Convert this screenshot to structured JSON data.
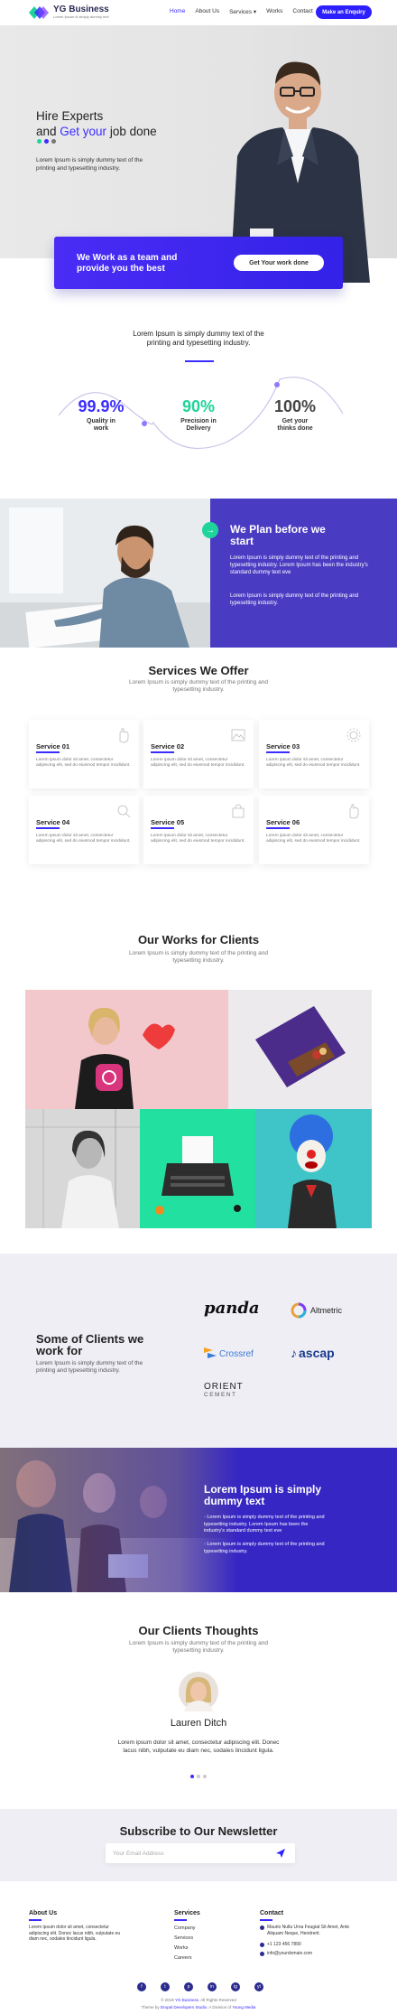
{
  "header": {
    "brand": "YG Business",
    "tagline": "Lorem Ipsum is simply dummy text",
    "nav": [
      "Home",
      "About Us",
      "Services",
      "Works",
      "Contact"
    ],
    "services_caret": "▾",
    "cta": "Make an Enquiry"
  },
  "hero": {
    "title_line1": "Hire Experts",
    "title_and": "and ",
    "title_accent": "Get your",
    "title_rest": " job done",
    "description": "Lorem Ipsum is simply dummy text of the printing and typesetting industry.",
    "dot_colors": [
      "#1ed49a",
      "#3a2cff",
      "#777777"
    ]
  },
  "cta_bar": {
    "text": "We Work as a team and provide you the best",
    "button": "Get Your work done"
  },
  "stats": {
    "heading": "Lorem Ipsum is simply dummy text of the printing and typesetting industry.",
    "items": [
      {
        "value": "99.9%",
        "label": "Quality in work",
        "color": "#3a2cff"
      },
      {
        "value": "90%",
        "label": "Precision in Delivery",
        "color": "#1ed49a"
      },
      {
        "value": "100%",
        "label": "Get your thinks done",
        "color": "#444444"
      }
    ]
  },
  "plan": {
    "arrow": "→",
    "title": "We Plan before we start",
    "p1": "Lorem Ipsum is simply dummy text of the printing and typesetting industry. Lorem Ipsum has been the industry's standard dummy text eve",
    "p2": "Lorem Ipsum is simply dummy text of the printing and typesetting industry."
  },
  "services": {
    "title": "Services We Offer",
    "subtitle": "Lorem Ipsum is simply dummy text of the printing and typesetting industry.",
    "items": [
      {
        "title": "Service 01",
        "desc": "Lorem ipsum dolor sit amet, consectetur adipiscing elit, sed do eiusmod tempor incididunt."
      },
      {
        "title": "Service 02",
        "desc": "Lorem ipsum dolor sit amet, consectetur adipiscing elit, sed do eiusmod tempor incididunt."
      },
      {
        "title": "Service 03",
        "desc": "Lorem ipsum dolor sit amet, consectetur adipiscing elit, sed do eiusmod tempor incididunt."
      },
      {
        "title": "Service 04",
        "desc": "Lorem ipsum dolor sit amet, consectetur adipiscing elit, sed do eiusmod tempor incididunt."
      },
      {
        "title": "Service 05",
        "desc": "Lorem ipsum dolor sit amet, consectetur adipiscing elit, sed do eiusmod tempor incididunt."
      },
      {
        "title": "Service 06",
        "desc": "Lorem ipsum dolor sit amet, consectetur adipiscing elit, sed do eiusmod tempor incididunt."
      }
    ]
  },
  "works": {
    "title": "Our Works for Clients",
    "subtitle": "Lorem Ipsum is simply dummy text of the printing and typesetting industry."
  },
  "clients": {
    "title": "Some of Clients we work for",
    "description": "Lorem Ipsum is simply dummy text of the printing and typesetting industry.",
    "logos": [
      "panda",
      "Altmetric",
      "Crossref",
      "ascap",
      "ORIENT",
      "CEMENT"
    ]
  },
  "band": {
    "title": "Lorem Ipsum is simply dummy text",
    "p1": "- Lorem Ipsum is simply dummy text of the printing and typesetting industry. Lorem Ipsum has been the industry's standard dummy text eve",
    "p2": "- Lorem Ipsum is simply dummy text of the printing and typesetting industry."
  },
  "testimonials": {
    "title": "Our Clients Thoughts",
    "subtitle": "Lorem Ipsum is simply dummy text of the printing and typesetting industry.",
    "name": "Lauren Ditch",
    "quote": "Lorem ipsum dolor sit amet, consectetur adipiscing elit. Donec lacus nibh, vulputate eu diam nec, sodales tincidunt ligula."
  },
  "newsletter": {
    "title": "Subscribe to Our Newsletter",
    "placeholder": "Your Email Address"
  },
  "footer": {
    "about_title": "About Us",
    "about_text": "Lorem ipsum dolor sit amet, consectetur adipiscing elit. Donec lacus nibh, vulputate eu diam nec, sodales tincidunt ligula.",
    "services_title": "Services",
    "services_links": [
      "Company",
      "Services",
      "Works",
      "Careers"
    ],
    "contact_title": "Contact",
    "address": "Maurio Nulla Urna Feugiat Sit Amet, Ante Aliquam Neque, Hendrerit.",
    "phone": "+1 123 456 7890",
    "email": "info@yourdomain.com",
    "social": [
      "f",
      "t",
      "p",
      "in",
      "ig",
      "yt"
    ],
    "copyright_pre": "© 2019 ",
    "copyright_brand": "YG Business",
    "copyright_post": ". All Rights Reserved",
    "credit_pre": "Theme by ",
    "credit_link": "Drupal Developers Studio",
    "credit_mid": ". A Division of ",
    "credit_link2": "Young Media"
  }
}
